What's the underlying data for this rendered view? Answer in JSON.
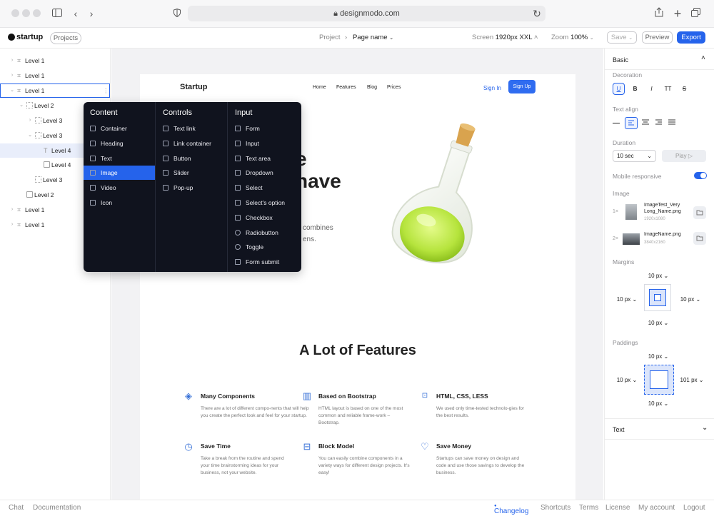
{
  "browser": {
    "url": "designmodo.com"
  },
  "app": {
    "logo": "startup",
    "projects_button": "Projects",
    "breadcrumb_project": "Project",
    "breadcrumb_sep": "›",
    "page_name": "Page name",
    "screen_label": "Screen",
    "screen_value": "1920px XXL",
    "zoom_label": "Zoom",
    "zoom_value": "100%",
    "save": "Save",
    "preview": "Preview",
    "export": "Export"
  },
  "tree": [
    {
      "label": "Level 1"
    },
    {
      "label": "Level 1"
    },
    {
      "label": "Level 1"
    },
    {
      "label": "Level 2"
    },
    {
      "label": "Level 3"
    },
    {
      "label": "Level 3"
    },
    {
      "label": "Level 4"
    },
    {
      "label": "Level 4"
    },
    {
      "label": "Level 3"
    },
    {
      "label": "Level 2"
    },
    {
      "label": "Level 1"
    },
    {
      "label": "Level 1"
    }
  ],
  "menu": {
    "content": {
      "title": "Content",
      "items": [
        "Container",
        "Heading",
        "Text",
        "Image",
        "Video",
        "Icon"
      ]
    },
    "controls": {
      "title": "Controls",
      "items": [
        "Text link",
        "Link container",
        "Button",
        "Slider",
        "Pop-up"
      ]
    },
    "input": {
      "title": "Input",
      "items": [
        "Form",
        "Input",
        "Text area",
        "Dropdown",
        "Select",
        "Select's option",
        "Checkbox",
        "Radiobutton",
        "Toggle",
        "Form submit"
      ]
    }
  },
  "site": {
    "brand": "Startup",
    "nav": [
      "Home",
      "Features",
      "Blog",
      "Prices"
    ],
    "signin": "Sign In",
    "signup": "Sign Up",
    "hero_partial_1": "e",
    "hero_partial_2": "have",
    "hero_sub_1": "combines",
    "hero_sub_2": "ens.",
    "features_title": "A Lot of Features",
    "features": [
      {
        "title": "Many Components",
        "desc": "There are a lot of different compo-nents that will help you create the perfect look and feel for your startup."
      },
      {
        "title": "Based on Bootstrap",
        "desc": "HTML layout is based on one of the most common and reliable frame-work – Bootstrap."
      },
      {
        "title": "HTML, CSS, LESS",
        "desc": "We used only time-tested technolo-gies for the best results."
      },
      {
        "title": "Save Time",
        "desc": "Take a break from the routine and spend your time brainstorming ideas for your business, not your website."
      },
      {
        "title": "Block Model",
        "desc": "You can easily combine components in a variety ways for different design projects. It's easy!"
      },
      {
        "title": "Save Money",
        "desc": "Startups can save money on design and code and use those savings to develop the business."
      }
    ]
  },
  "panel": {
    "basic": "Basic",
    "decoration": "Decoration",
    "deco_buttons": [
      "U",
      "B",
      "I",
      "TT",
      "S"
    ],
    "text_align": "Text align",
    "duration": "Duration",
    "duration_value": "10 sec",
    "play": "Play ▷",
    "mobile_responsive": "Mobile responsive",
    "mobile_responsive_on": true,
    "image": "Image",
    "images": [
      {
        "idx": "1×",
        "name": "ImageTest_Very Long_Name.png",
        "size": "1920x1080"
      },
      {
        "idx": "2×",
        "name": "ImageName.png",
        "size": "3840x2160"
      }
    ],
    "margins": "Margins",
    "margin_top": "10 px",
    "margin_left": "10 px",
    "margin_right": "10 px",
    "margin_bottom": "10 px",
    "paddings": "Paddings",
    "padding_top": "10 px",
    "padding_left": "10 px",
    "padding_right": "101 px",
    "padding_bottom": "10 px",
    "text": "Text"
  },
  "footer": {
    "chat": "Chat",
    "documentation": "Documentation",
    "changelog": "Changelog",
    "shortcuts": "Shortcuts",
    "terms": "Terms",
    "license": "License",
    "my_account": "My account",
    "logout": "Logout"
  },
  "colors": {
    "accent": "#2563eb",
    "menu_bg": "#10131e",
    "flask_liquid": "#c8ef5a"
  }
}
